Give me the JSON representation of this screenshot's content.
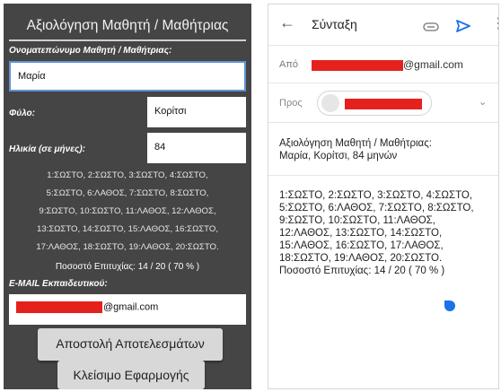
{
  "form": {
    "title": "Αξιολόγηση Μαθητή / Μαθήτριας",
    "name_label": "Ονοματεπώνυμο Μαθητή / Μαθήτριας:",
    "name_value": "Μαρία",
    "gender_label": "Φύλο:",
    "gender_value": "Κορίτσι",
    "age_label": "Ηλικία (σε μήνες):",
    "age_value": "84",
    "results_lines": [
      "1:ΣΩΣΤΟ, 2:ΣΩΣΤΟ, 3:ΣΩΣΤΟ, 4:ΣΩΣΤΟ,",
      "5:ΣΩΣΤΟ, 6:ΛΑΘΟΣ, 7:ΣΩΣΤΟ, 8:ΣΩΣΤΟ,",
      "9:ΣΩΣΤΟ, 10:ΣΩΣΤΟ, 11:ΛΑΘΟΣ, 12:ΛΑΘΟΣ,",
      "13:ΣΩΣΤΟ, 14:ΣΩΣΤΟ, 15:ΛΑΘΟΣ, 16:ΣΩΣΤΟ,",
      "17:ΛΑΘΟΣ, 18:ΣΩΣΤΟ, 19:ΛΑΘΟΣ, 20:ΣΩΣΤΟ."
    ],
    "score": "Ποσοστό Επιτυχίας: 14 / 20 ( 70 % )",
    "email_label": "E-MAIL Εκπαιδευτικού:",
    "email_suffix": "@gmail.com",
    "send_button": "Αποστολή Αποτελεσμάτων",
    "close_button": "Κλείσιμο Εφαρμογής"
  },
  "mail": {
    "title": "Σύνταξη",
    "from_label": "Από",
    "from_suffix": "@gmail.com",
    "to_label": "Προς",
    "subject_line1": "Αξιολόγηση Μαθητή / Μαθήτριας:",
    "subject_line2": "Μαρία, Κορίτσι, 84 μηνών",
    "body": "1:ΣΩΣΤΟ, 2:ΣΩΣΤΟ, 3:ΣΩΣΤΟ, 4:ΣΩΣΤΟ,\n5:ΣΩΣΤΟ, 6:ΛΑΘΟΣ, 7:ΣΩΣΤΟ, 8:ΣΩΣΤΟ,\n9:ΣΩΣΤΟ, 10:ΣΩΣΤΟ, 11:ΛΑΘΟΣ,\n12:ΛΑΘΟΣ, 13:ΣΩΣΤΟ, 14:ΣΩΣΤΟ,\n15:ΛΑΘΟΣ, 16:ΣΩΣΤΟ, 17:ΛΑΘΟΣ,\n18:ΣΩΣΤΟ, 19:ΛΑΘΟΣ, 20:ΣΩΣΤΟ.\nΠοσοστό Επιτυχίας: 14 / 20 ( 70 % )",
    "icons": [
      "back-arrow-icon",
      "attachment-icon",
      "send-icon",
      "more-vert-icon",
      "chevron-down-icon"
    ]
  },
  "colors": {
    "form_background": "#454545",
    "input_focus_border": "#5e93d6",
    "redaction": "#e5211d",
    "mail_accent": "#1a73e8"
  }
}
